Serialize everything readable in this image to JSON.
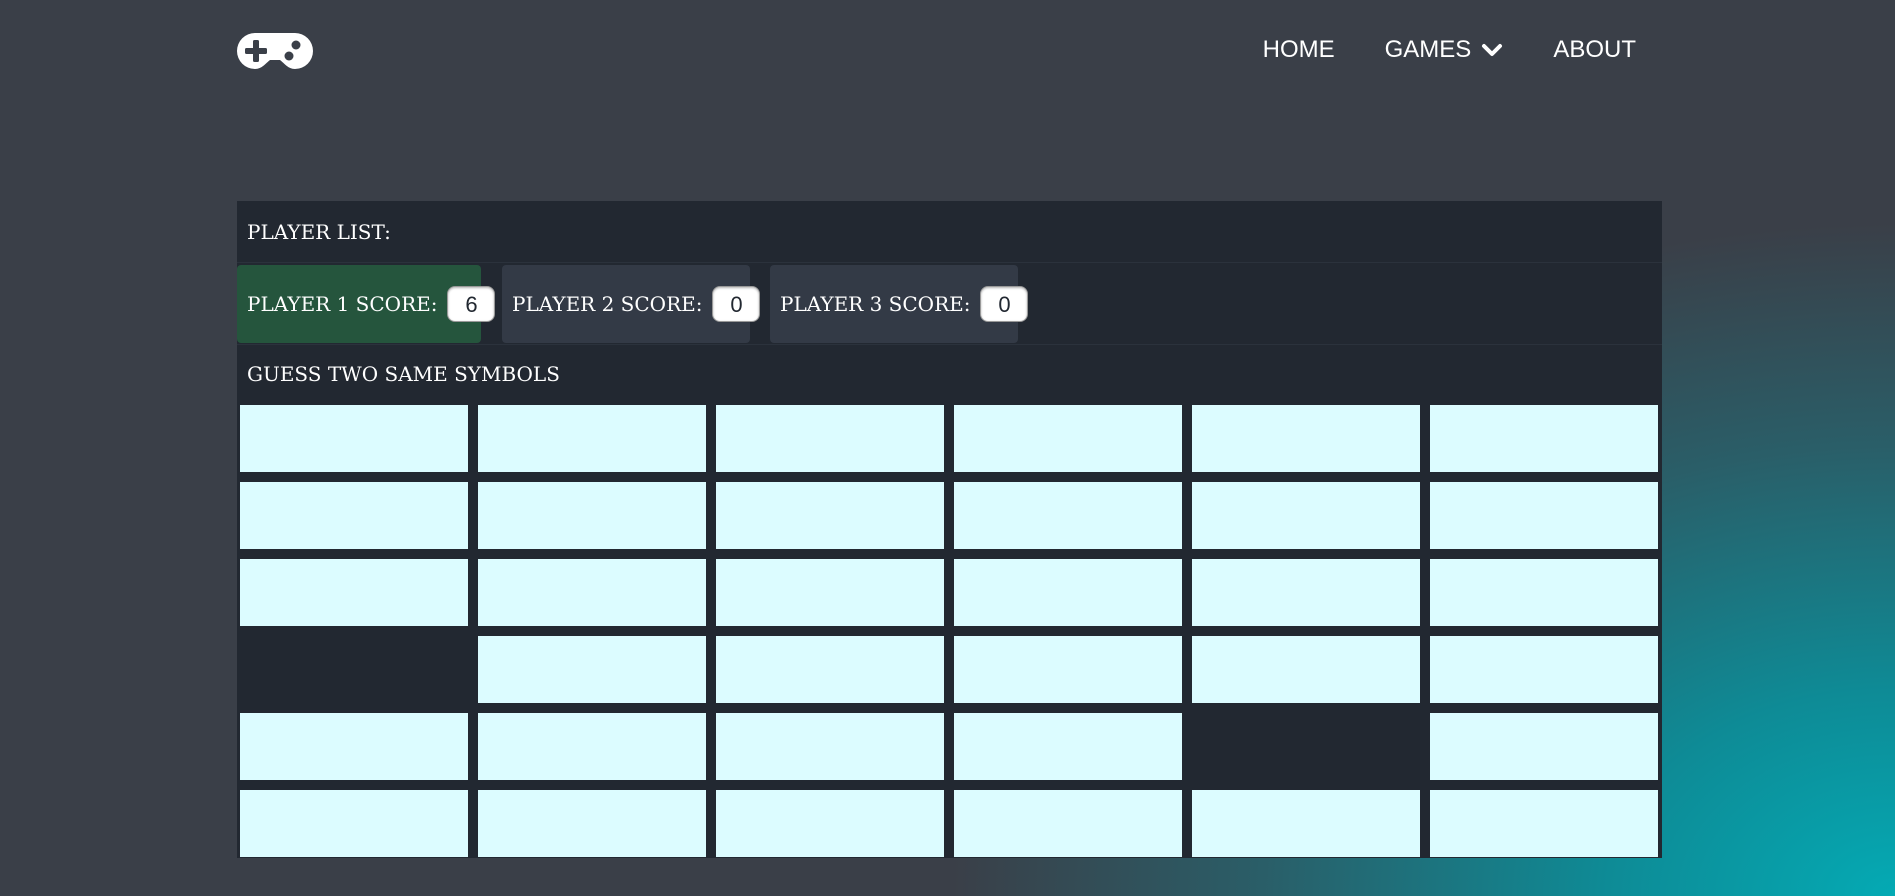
{
  "nav": {
    "logo_icon": "gamepad-icon",
    "home": "HOME",
    "games": "GAMES",
    "games_icon": "chevron-down-icon",
    "about": "ABOUT"
  },
  "panel": {
    "header": "PLAYER LIST:",
    "players": [
      {
        "label": "PLAYER 1 SCORE:",
        "score": "6",
        "active": true
      },
      {
        "label": "PLAYER 2 SCORE:",
        "score": "0",
        "active": false
      },
      {
        "label": "PLAYER 3 SCORE:",
        "score": "0",
        "active": false
      }
    ],
    "instruction": "GUESS TWO SAME SYMBOLS"
  },
  "board": {
    "rows": 6,
    "columns": 6,
    "cells": [
      [
        "hidden",
        "hidden",
        "hidden",
        "hidden",
        "hidden",
        "hidden"
      ],
      [
        "hidden",
        "hidden",
        "hidden",
        "hidden",
        "hidden",
        "hidden"
      ],
      [
        "hidden",
        "hidden",
        "hidden",
        "hidden",
        "hidden",
        "hidden"
      ],
      [
        "matched",
        "hidden",
        "hidden",
        "hidden",
        "hidden",
        "hidden"
      ],
      [
        "hidden",
        "hidden",
        "hidden",
        "hidden",
        "matched",
        "hidden"
      ],
      [
        "hidden",
        "hidden",
        "hidden",
        "hidden",
        "hidden",
        "hidden"
      ]
    ]
  },
  "colors": {
    "card_hidden": "#dcfcff",
    "panel_bg": "#222831",
    "active_player_bg": "#25553d",
    "inactive_player_bg": "#333a46",
    "accent_teal": "#04aab4"
  }
}
